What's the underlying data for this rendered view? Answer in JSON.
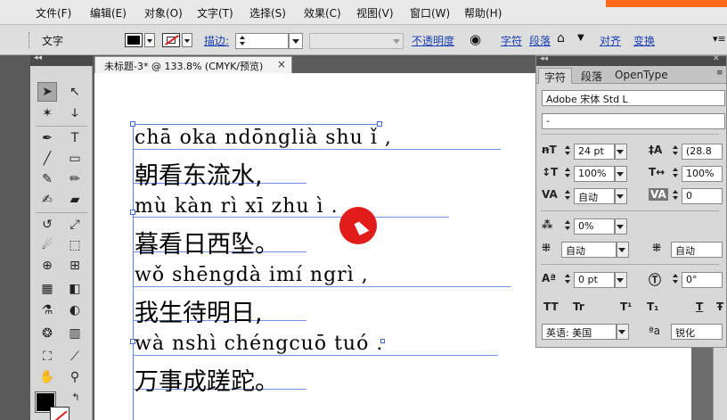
{
  "menu": {
    "items": [
      "文件(F)",
      "编辑(E)",
      "对象(O)",
      "文字(T)",
      "选择(S)",
      "效果(C)",
      "视图(V)",
      "窗口(W)",
      "帮助(H)"
    ]
  },
  "control_bar": {
    "tool_label": "文字",
    "stroke_label": "描边:",
    "opacity_label": "不透明度",
    "char_link": "字符",
    "para_link": "段落",
    "align_link": "对齐",
    "transform_link": "变换"
  },
  "document": {
    "tab_title": "未标题-3* @ 133.8% (CMYK/预览)",
    "close_glyph": "×",
    "lines": [
      {
        "kind": "pinyin",
        "text": "chā oka ndōnglià  shu ǐ ,"
      },
      {
        "kind": "hanzi",
        "text": "朝看东流水,"
      },
      {
        "kind": "pinyin",
        "text": "mù kàn rì  xī  zhu ì ."
      },
      {
        "kind": "hanzi",
        "text": "暮看日西坠。"
      },
      {
        "kind": "pinyin",
        "text": "wǒ shēngdà imí ngrì ,"
      },
      {
        "kind": "hanzi",
        "text": "我生待明日,"
      },
      {
        "kind": "pinyin",
        "text": "wà nshì  chéngcuō tuó ."
      },
      {
        "kind": "hanzi",
        "text": "万事成蹉跎。"
      }
    ]
  },
  "char_panel": {
    "tabs": [
      "字符",
      "段落",
      "OpenType"
    ],
    "font_family": "Adobe 宋体 Std L",
    "font_style": "-",
    "font_size": "24 pt",
    "leading": "(28.8",
    "vertical_scale": "100%",
    "horizontal_scale": "100%",
    "kerning": "自动",
    "tracking": "0",
    "tsume": "0%",
    "aki_left": "自动",
    "aki_right": "自动",
    "baseline_shift": "0 pt",
    "rotation": "0°",
    "language": "英语: 美国",
    "antialias_icon": "ªa",
    "antialias": "锐化",
    "style_buttons": [
      "TT",
      "Tr",
      "T¹",
      "T₁",
      "T",
      "Ŧ"
    ]
  }
}
